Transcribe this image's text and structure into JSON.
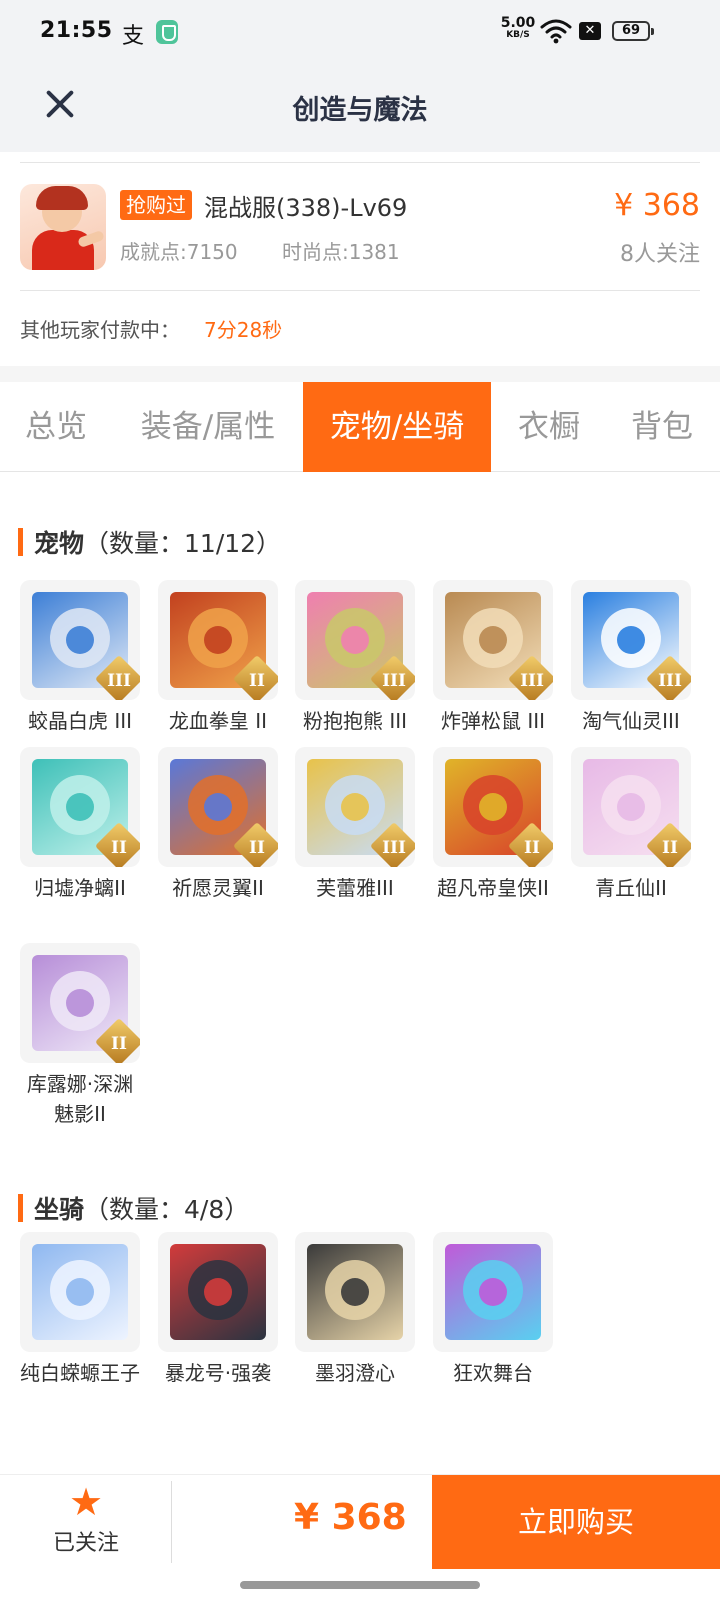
{
  "status_bar": {
    "time": "21:55",
    "app_icon": "支",
    "speed_value": "5.00",
    "speed_unit": "KB/S",
    "battery": "69"
  },
  "header": {
    "title": "创造与魔法"
  },
  "product": {
    "tag": "抢购过",
    "title": "混战服(338)-Lv69",
    "achievement": "成就点:7150",
    "fashion": "时尚点:1381",
    "price": "¥ 368",
    "followers": "8人关注",
    "paying_label": "其他玩家付款中：",
    "paying_time": "7分28秒"
  },
  "tabs": [
    {
      "label": "总览"
    },
    {
      "label": "装备/属性"
    },
    {
      "label": "宠物/坐骑",
      "active": true
    },
    {
      "label": "衣橱"
    },
    {
      "label": "背包"
    }
  ],
  "pets": {
    "title": "宠物",
    "count": "（数量：11/12）",
    "items": [
      {
        "name": "蛟晶白虎 III",
        "badge": "III",
        "colors": [
          "#3d7fd6",
          "#dfe8f5"
        ]
      },
      {
        "name": "龙血拳皇 II",
        "badge": "II",
        "colors": [
          "#c2411f",
          "#f0a24a"
        ]
      },
      {
        "name": "粉抱抱熊 III",
        "badge": "III",
        "colors": [
          "#ef7fb0",
          "#c9c86a"
        ]
      },
      {
        "name": "炸弹松鼠 III",
        "badge": "III",
        "colors": [
          "#b98a52",
          "#f2ddb8"
        ]
      },
      {
        "name": "淘气仙灵III",
        "badge": "III",
        "colors": [
          "#2a7fe0",
          "#ffffff"
        ]
      },
      {
        "name": "归墟净螭II",
        "badge": "II",
        "colors": [
          "#3ec0b8",
          "#bff0ea"
        ]
      },
      {
        "name": "祈愿灵翼II",
        "badge": "II",
        "colors": [
          "#5a78d8",
          "#e2702a"
        ]
      },
      {
        "name": "芙蕾雅III",
        "badge": "III",
        "colors": [
          "#e8c24a",
          "#c8dcf5"
        ]
      },
      {
        "name": "超凡帝皇侠II",
        "badge": "II",
        "colors": [
          "#e0b429",
          "#d8432a"
        ]
      },
      {
        "name": "青丘仙II",
        "badge": "II",
        "colors": [
          "#e7b9e6",
          "#f6dff0"
        ]
      },
      {
        "name": "库露娜·深渊魅影II",
        "badge": "II",
        "colors": [
          "#b78ed8",
          "#eee7f7"
        ]
      }
    ]
  },
  "mounts": {
    "title": "坐骑",
    "count": "（数量：4/8）",
    "items": [
      {
        "name": "纯白蝾螈王子",
        "colors": [
          "#8fb8f0",
          "#eef4ff"
        ]
      },
      {
        "name": "暴龙号·强袭",
        "colors": [
          "#d23b3b",
          "#2a3340"
        ]
      },
      {
        "name": "墨羽澄心",
        "colors": [
          "#3a3a3a",
          "#e6d3a8"
        ]
      },
      {
        "name": "狂欢舞台",
        "colors": [
          "#c05ad8",
          "#59d0f0"
        ]
      }
    ]
  },
  "bottom": {
    "follow_label": "已关注",
    "price": "¥ 368",
    "buy_label": "立即购买"
  },
  "colors": {
    "accent": "#ff6a13",
    "header_bg": "#f2f3f5"
  }
}
